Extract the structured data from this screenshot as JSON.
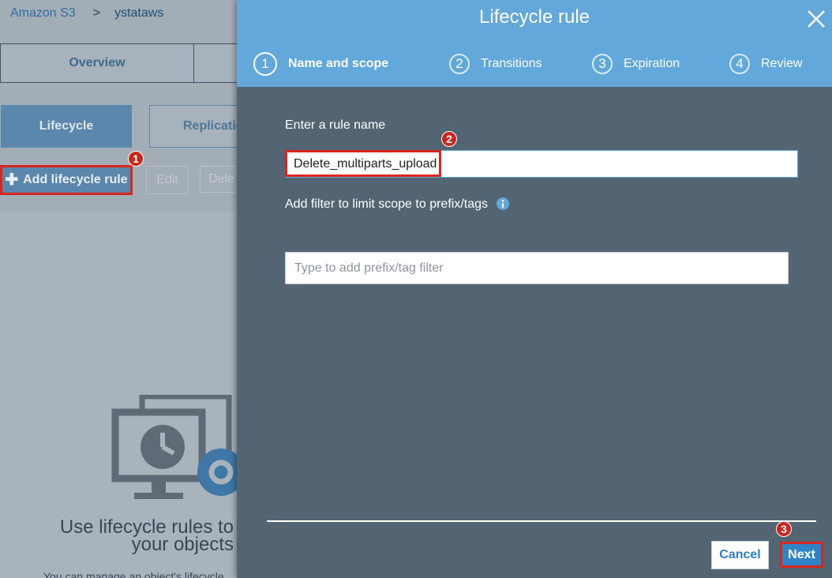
{
  "background": {
    "breadcrumb": {
      "root": "Amazon S3",
      "separator": ">",
      "bucket": "ystataws"
    },
    "tabs": [
      "Overview",
      ""
    ],
    "subtabs": {
      "active": "Lifecycle",
      "inactive": "Replicatio"
    },
    "actions": {
      "add": "Add lifecycle rule",
      "edit": "Edit",
      "delete": "Dele"
    },
    "empty_state": {
      "title_line1": "Use lifecycle rules to",
      "title_line2": "your objects",
      "text": "You can manage an object's lifecycle"
    }
  },
  "modal": {
    "title": "Lifecycle rule",
    "steps": [
      {
        "num": "1",
        "label": "Name and scope"
      },
      {
        "num": "2",
        "label": "Transitions"
      },
      {
        "num": "3",
        "label": "Expiration"
      },
      {
        "num": "4",
        "label": "Review"
      }
    ],
    "rule_name_label": "Enter a rule name",
    "rule_name_value": "Delete_multiparts_upload",
    "filter_label": "Add filter to limit scope to prefix/tags",
    "filter_placeholder": "Type to add prefix/tag filter",
    "cancel_label": "Cancel",
    "next_label": "Next"
  },
  "annotations": [
    "1",
    "2",
    "3"
  ],
  "colors": {
    "highlight": "#d7271e",
    "header": "#62a8db",
    "modal_body": "#536473",
    "primary": "#2e84c6"
  }
}
